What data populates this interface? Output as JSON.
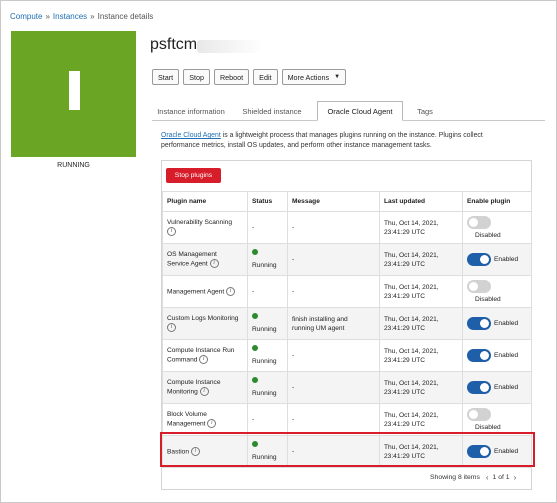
{
  "breadcrumb": [
    {
      "label": "Compute",
      "link": true
    },
    {
      "label": "Instances",
      "link": true
    },
    {
      "label": "Instance details",
      "link": false
    }
  ],
  "breadcrumb_sep": "»",
  "instance": {
    "name": "psftcm",
    "state": "RUNNING",
    "status_color": "#6aa624"
  },
  "actions": {
    "start": "Start",
    "stop": "Stop",
    "reboot": "Reboot",
    "edit": "Edit",
    "more": "More Actions"
  },
  "tabs": [
    {
      "label": "Instance information",
      "active": false
    },
    {
      "label": "Shielded instance",
      "active": false
    },
    {
      "label": "Oracle Cloud Agent",
      "active": true
    },
    {
      "label": "Tags",
      "active": false
    }
  ],
  "description": {
    "link_text": "Oracle Cloud Agent",
    "line1_rest": " is a lightweight process that manages plugins running on the instance. Plugins collect",
    "line2": "performance metrics, install OS updates, and perform other instance management tasks."
  },
  "stop_plugins_label": "Stop plugins",
  "table": {
    "headers": [
      "Plugin name",
      "Status",
      "Message",
      "Last updated",
      "Enable plugin"
    ],
    "rows": [
      {
        "name_l1": "Vulnerability Scanning",
        "name_l2": "",
        "status": "-",
        "running": false,
        "message_l1": "-",
        "message_l2": "",
        "updated_l1": "Thu, Oct 14, 2021,",
        "updated_l2": "23:41:29 UTC",
        "enabled": false,
        "toggle_label": "Disabled"
      },
      {
        "name_l1": "OS Management",
        "name_l2": "Service Agent",
        "status": "Running",
        "running": true,
        "message_l1": "-",
        "message_l2": "",
        "updated_l1": "Thu, Oct 14, 2021,",
        "updated_l2": "23:41:29 UTC",
        "enabled": true,
        "toggle_label": "Enabled"
      },
      {
        "name_l1": "Management Agent",
        "name_l2": "",
        "status": "-",
        "running": false,
        "message_l1": "-",
        "message_l2": "",
        "updated_l1": "Thu, Oct 14, 2021,",
        "updated_l2": "23:41:29 UTC",
        "enabled": false,
        "toggle_label": "Disabled"
      },
      {
        "name_l1": "Custom Logs Monitoring",
        "name_l2": "",
        "status": "Running",
        "running": true,
        "message_l1": "finish installing and",
        "message_l2": "running UM agent",
        "updated_l1": "Thu, Oct 14, 2021,",
        "updated_l2": "23:41:29 UTC",
        "enabled": true,
        "toggle_label": "Enabled"
      },
      {
        "name_l1": "Compute Instance Run",
        "name_l2": "Command",
        "status": "Running",
        "running": true,
        "message_l1": "-",
        "message_l2": "",
        "updated_l1": "Thu, Oct 14, 2021,",
        "updated_l2": "23:41:29 UTC",
        "enabled": true,
        "toggle_label": "Enabled"
      },
      {
        "name_l1": "Compute Instance",
        "name_l2": "Monitoring",
        "status": "Running",
        "running": true,
        "message_l1": "-",
        "message_l2": "",
        "updated_l1": "Thu, Oct 14, 2021,",
        "updated_l2": "23:41:29 UTC",
        "enabled": true,
        "toggle_label": "Enabled"
      },
      {
        "name_l1": "Block Volume",
        "name_l2": "Management",
        "status": "-",
        "running": false,
        "message_l1": "-",
        "message_l2": "",
        "updated_l1": "Thu, Oct 14, 2021,",
        "updated_l2": "23:41:29 UTC",
        "enabled": false,
        "toggle_label": "Disabled"
      },
      {
        "name_l1": "Bastion",
        "name_l2": "",
        "status": "Running",
        "running": true,
        "message_l1": "-",
        "message_l2": "",
        "updated_l1": "Thu, Oct 14, 2021,",
        "updated_l2": "23:41:29 UTC",
        "enabled": true,
        "toggle_label": "Enabled"
      }
    ]
  },
  "highlighted_row": "Bastion",
  "footer": {
    "showing": "Showing 8 items",
    "page": "1 of 1"
  },
  "colors": {
    "accent_red": "#d71d2a",
    "toggle_on": "#1f5ea8",
    "running_dot": "#2f8a2f",
    "link": "#1f6fb5"
  }
}
